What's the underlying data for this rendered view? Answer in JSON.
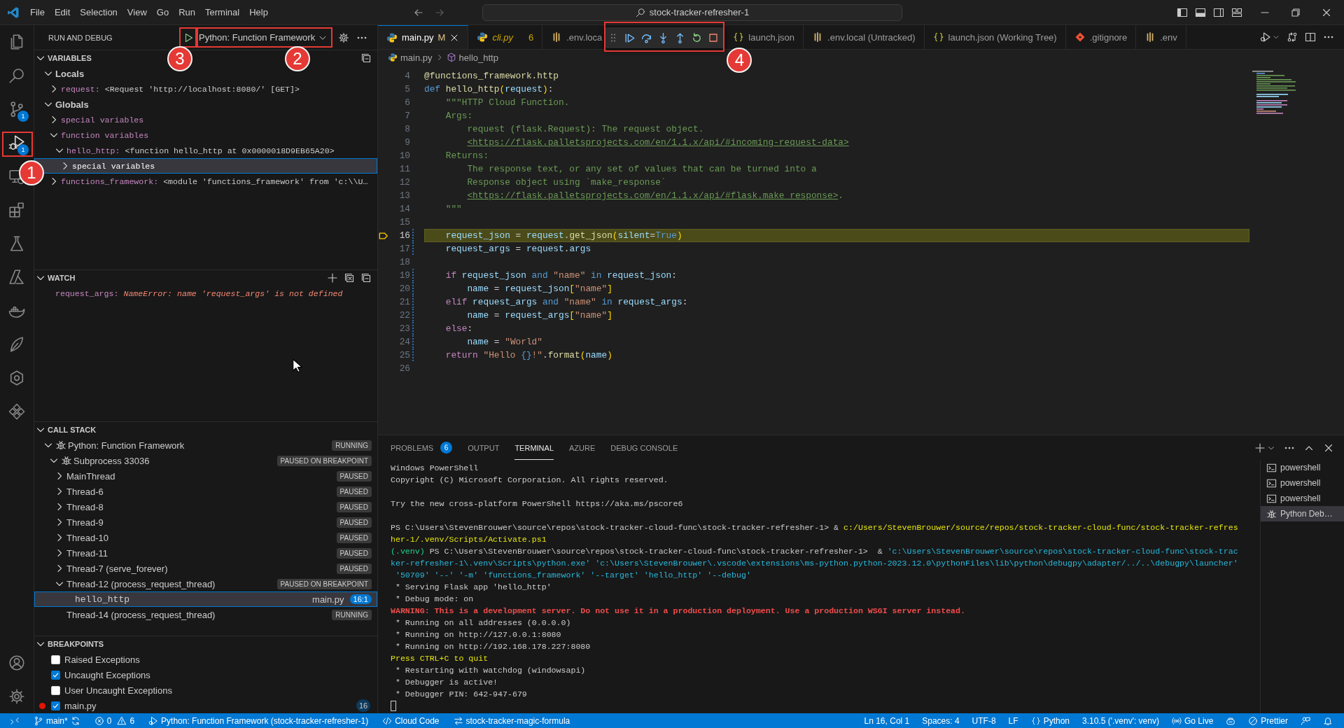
{
  "title_bar": {
    "menu": [
      "File",
      "Edit",
      "Selection",
      "View",
      "Go",
      "Run",
      "Terminal",
      "Help"
    ],
    "search": "stock-tracker-refresher-1"
  },
  "activity_bar": {
    "items": [
      {
        "selected": false
      },
      {
        "selected": false
      },
      {
        "selected": false,
        "badge": "1"
      },
      {
        "selected": true,
        "badge": "1",
        "marker": "1"
      },
      {
        "selected": false
      },
      {
        "selected": false
      },
      {
        "selected": false
      },
      {
        "selected": false
      },
      {
        "selected": false
      },
      {
        "selected": false
      },
      {
        "selected": false
      },
      {
        "selected": false
      }
    ],
    "bottom": [
      {
        "selected": false
      },
      {
        "selected": false
      }
    ]
  },
  "sidebar": {
    "title": "RUN AND DEBUG",
    "start_button": {
      "marker": "3"
    },
    "config": {
      "label": "Python: Function Framework",
      "marker": "2"
    },
    "variables": {
      "title": "VARIABLES",
      "expanded": true,
      "scopes": [
        {
          "name": "Locals",
          "expanded": true,
          "children": [
            {
              "name": "request:",
              "value": "<Request 'http://localhost:8080/' [GET]>",
              "expanded": false,
              "selected": false
            }
          ]
        },
        {
          "name": "Globals",
          "expanded": true,
          "children": [
            {
              "name": "special variables",
              "expanded": false,
              "selected": false
            },
            {
              "name": "function variables",
              "expanded": true,
              "selected": false,
              "children": [
                {
                  "name": "hello_http:",
                  "value": "<function hello_http at 0x0000018D9EB65A20>",
                  "expanded": true,
                  "selected": false,
                  "children": [
                    {
                      "name": "special variables",
                      "expanded": false,
                      "selected": true
                    }
                  ]
                }
              ]
            },
            {
              "name": "functions_framework:",
              "value": "<module 'functions_framework' from 'c:\\\\U…",
              "expanded": false,
              "selected": false
            }
          ]
        }
      ]
    },
    "watch": {
      "title": "WATCH",
      "expanded": true,
      "items": [
        {
          "name": "request_args:",
          "error": "NameError: name 'request_args' is not defined"
        }
      ]
    },
    "call_stack": {
      "title": "CALL STACK",
      "expanded": true,
      "items": [
        {
          "kind": "session",
          "label": "Python: Function Framework",
          "status": "RUNNING",
          "expanded": true,
          "selected": false,
          "children": [
            {
              "kind": "session",
              "label": "Subprocess 33036",
              "status": "PAUSED ON BREAKPOINT",
              "expanded": true,
              "selected": false,
              "children": [
                {
                  "kind": "thread",
                  "label": "MainThread",
                  "status": "PAUSED",
                  "expanded": false,
                  "selected": false
                },
                {
                  "kind": "thread",
                  "label": "Thread-6",
                  "status": "PAUSED",
                  "expanded": false,
                  "selected": false
                },
                {
                  "kind": "thread",
                  "label": "Thread-8",
                  "status": "PAUSED",
                  "expanded": false,
                  "selected": false
                },
                {
                  "kind": "thread",
                  "label": "Thread-9",
                  "status": "PAUSED",
                  "expanded": false,
                  "selected": false
                },
                {
                  "kind": "thread",
                  "label": "Thread-10",
                  "status": "PAUSED",
                  "expanded": false,
                  "selected": false
                },
                {
                  "kind": "thread",
                  "label": "Thread-11",
                  "status": "PAUSED",
                  "expanded": false,
                  "selected": false
                },
                {
                  "kind": "thread",
                  "label": "Thread-7 (serve_forever)",
                  "status": "PAUSED",
                  "expanded": false,
                  "selected": false
                },
                {
                  "kind": "thread",
                  "label": "Thread-12 (process_request_thread)",
                  "status": "PAUSED ON BREAKPOINT",
                  "expanded": true,
                  "selected": false,
                  "children": [
                    {
                      "kind": "frame",
                      "label": "hello_http",
                      "file": "main.py",
                      "position": "16:1",
                      "selected": true
                    }
                  ]
                },
                {
                  "kind": "thread",
                  "label": "Thread-14 (process_request_thread)",
                  "status": "RUNNING",
                  "selected": false
                }
              ]
            }
          ]
        }
      ]
    },
    "breakpoints": {
      "title": "BREAKPOINTS",
      "expanded": true,
      "items": [
        {
          "kind": "exception",
          "label": "Raised Exceptions",
          "checked": false
        },
        {
          "kind": "exception",
          "label": "Uncaught Exceptions",
          "checked": true
        },
        {
          "kind": "exception",
          "label": "User Uncaught Exceptions",
          "checked": false
        },
        {
          "kind": "file",
          "label": "main.py",
          "checked": true,
          "line": "16"
        }
      ]
    }
  },
  "editor": {
    "tabs": [
      {
        "kind": "python",
        "label": "main.py",
        "selected": true,
        "preview": false,
        "clipped": false,
        "git_status": "M"
      },
      {
        "kind": "python",
        "label": "cli.py",
        "selected": false,
        "preview": true,
        "clipped": false,
        "problems": "6"
      },
      {
        "kind": "env",
        "label": ".env.loca",
        "selected": false,
        "preview": false,
        "clipped": true
      },
      {
        "kind": "json",
        "label": "launch.json",
        "selected": false,
        "preview": false,
        "clipped": false
      },
      {
        "kind": "env",
        "label": ".env.local (Untracked)",
        "selected": false,
        "preview": false,
        "clipped": false
      },
      {
        "kind": "json",
        "label": "launch.json (Working Tree)",
        "selected": false,
        "preview": false,
        "clipped": false
      },
      {
        "kind": "git",
        "label": ".gitignore",
        "selected": false,
        "preview": false,
        "clipped": false
      },
      {
        "kind": "env",
        "label": ".env",
        "selected": false,
        "preview": false,
        "clipped": false
      }
    ],
    "debug_toolbar": {
      "marker": "4"
    },
    "breadcrumbs": [
      "main.py",
      "hello_http"
    ],
    "lines": [
      {
        "number": "4",
        "current": false,
        "changed": false,
        "segments": [
          {
            "kind": "fn",
            "text": "@functions_framework.http"
          }
        ]
      },
      {
        "number": "5",
        "current": false,
        "changed": false,
        "segments": [
          {
            "kind": "kw",
            "text": "def"
          },
          {
            "kind": "fn",
            "text": " hello_http"
          },
          {
            "kind": "br",
            "text": "("
          },
          {
            "kind": "var",
            "text": "request"
          },
          {
            "kind": "br",
            "text": ")"
          },
          {
            "kind": "plain",
            "text": ":"
          }
        ]
      },
      {
        "number": "6",
        "current": false,
        "changed": false,
        "segments": [
          {
            "kind": "doc",
            "text": "    \"\"\"HTTP Cloud Function."
          }
        ]
      },
      {
        "number": "7",
        "current": false,
        "changed": false,
        "segments": [
          {
            "kind": "doc",
            "text": "    Args:"
          }
        ]
      },
      {
        "number": "8",
        "current": false,
        "changed": false,
        "segments": [
          {
            "kind": "doc",
            "text": "        request (flask.Request): The request object."
          }
        ]
      },
      {
        "number": "9",
        "current": false,
        "changed": false,
        "segments": [
          {
            "kind": "link",
            "text": "        <https://flask.palletsprojects.com/en/1.1.x/api/#incoming-request-data>"
          }
        ]
      },
      {
        "number": "10",
        "current": false,
        "changed": false,
        "segments": [
          {
            "kind": "doc",
            "text": "    Returns:"
          }
        ]
      },
      {
        "number": "11",
        "current": false,
        "changed": false,
        "segments": [
          {
            "kind": "doc",
            "text": "        The response text, or any set of values that can be turned into a"
          }
        ]
      },
      {
        "number": "12",
        "current": false,
        "changed": false,
        "segments": [
          {
            "kind": "doc",
            "text": "        Response object using `make_response`"
          }
        ]
      },
      {
        "number": "13",
        "current": false,
        "changed": false,
        "segments": [
          {
            "kind": "link",
            "text": "        <https://flask.palletsprojects.com/en/1.1.x/api/#flask.make_response>"
          },
          {
            "kind": "doc",
            "text": "."
          }
        ]
      },
      {
        "number": "14",
        "current": false,
        "changed": false,
        "segments": [
          {
            "kind": "doc",
            "text": "    \"\"\""
          }
        ]
      },
      {
        "number": "15",
        "current": false,
        "changed": false
      },
      {
        "number": "16",
        "current": true,
        "changed": true,
        "segments": [
          {
            "kind": "var",
            "text": "    request_json"
          },
          {
            "kind": "plain",
            "text": " = "
          },
          {
            "kind": "var",
            "text": "request"
          },
          {
            "kind": "plain",
            "text": "."
          },
          {
            "kind": "fn",
            "text": "get_json"
          },
          {
            "kind": "br",
            "text": "("
          },
          {
            "kind": "var",
            "text": "silent"
          },
          {
            "kind": "plain",
            "text": "="
          },
          {
            "kind": "kw",
            "text": "True"
          },
          {
            "kind": "br",
            "text": ")"
          }
        ]
      },
      {
        "number": "17",
        "current": false,
        "changed": true,
        "segments": [
          {
            "kind": "var",
            "text": "    request_args"
          },
          {
            "kind": "plain",
            "text": " = "
          },
          {
            "kind": "var",
            "text": "request"
          },
          {
            "kind": "plain",
            "text": "."
          },
          {
            "kind": "var",
            "text": "args"
          }
        ]
      },
      {
        "number": "18",
        "current": false,
        "changed": false
      },
      {
        "number": "19",
        "current": false,
        "changed": true,
        "segments": [
          {
            "kind": "ctrl",
            "text": "    if"
          },
          {
            "kind": "var",
            "text": " request_json"
          },
          {
            "kind": "kw",
            "text": " and"
          },
          {
            "kind": "str",
            "text": " \"name\""
          },
          {
            "kind": "kw",
            "text": " in"
          },
          {
            "kind": "var",
            "text": " request_json"
          },
          {
            "kind": "plain",
            "text": ":"
          }
        ]
      },
      {
        "number": "20",
        "current": false,
        "changed": true,
        "segments": [
          {
            "kind": "var",
            "text": "        name"
          },
          {
            "kind": "plain",
            "text": " = "
          },
          {
            "kind": "var",
            "text": "request_json"
          },
          {
            "kind": "br",
            "text": "["
          },
          {
            "kind": "str",
            "text": "\"name\""
          },
          {
            "kind": "br",
            "text": "]"
          }
        ]
      },
      {
        "number": "21",
        "current": false,
        "changed": true,
        "segments": [
          {
            "kind": "ctrl",
            "text": "    elif"
          },
          {
            "kind": "var",
            "text": " request_args"
          },
          {
            "kind": "kw",
            "text": " and"
          },
          {
            "kind": "str",
            "text": " \"name\""
          },
          {
            "kind": "kw",
            "text": " in"
          },
          {
            "kind": "var",
            "text": " request_args"
          },
          {
            "kind": "plain",
            "text": ":"
          }
        ]
      },
      {
        "number": "22",
        "current": false,
        "changed": true,
        "segments": [
          {
            "kind": "var",
            "text": "        name"
          },
          {
            "kind": "plain",
            "text": " = "
          },
          {
            "kind": "var",
            "text": "request_args"
          },
          {
            "kind": "br",
            "text": "["
          },
          {
            "kind": "str",
            "text": "\"name\""
          },
          {
            "kind": "br",
            "text": "]"
          }
        ]
      },
      {
        "number": "23",
        "current": false,
        "changed": true,
        "segments": [
          {
            "kind": "ctrl",
            "text": "    else"
          },
          {
            "kind": "plain",
            "text": ":"
          }
        ]
      },
      {
        "number": "24",
        "current": false,
        "changed": true,
        "segments": [
          {
            "kind": "var",
            "text": "        name"
          },
          {
            "kind": "plain",
            "text": " = "
          },
          {
            "kind": "str",
            "text": "\"World\""
          }
        ]
      },
      {
        "number": "25",
        "current": false,
        "changed": true,
        "segments": [
          {
            "kind": "ctrl",
            "text": "    return"
          },
          {
            "kind": "str",
            "text": " \"Hello "
          },
          {
            "kind": "fmt",
            "text": "{}"
          },
          {
            "kind": "str",
            "text": "!\""
          },
          {
            "kind": "plain",
            "text": "."
          },
          {
            "kind": "fn",
            "text": "format"
          },
          {
            "kind": "br",
            "text": "("
          },
          {
            "kind": "var",
            "text": "name"
          },
          {
            "kind": "br",
            "text": ")"
          }
        ]
      },
      {
        "number": "26",
        "current": false,
        "changed": false
      }
    ]
  },
  "panel": {
    "tabs": [
      {
        "label": "PROBLEMS",
        "selected": false,
        "badge": "6"
      },
      {
        "label": "OUTPUT",
        "selected": false
      },
      {
        "label": "TERMINAL",
        "selected": true
      },
      {
        "label": "AZURE",
        "selected": false
      },
      {
        "label": "DEBUG CONSOLE",
        "selected": false
      }
    ],
    "terminal": {
      "rows": [
        {
          "kind": "text",
          "segments": [
            {
              "kind": "plain",
              "text": "Windows PowerShell"
            }
          ]
        },
        {
          "kind": "text",
          "segments": [
            {
              "kind": "plain",
              "text": "Copyright (C) Microsoft Corporation. All rights reserved."
            }
          ]
        },
        {
          "kind": "blank"
        },
        {
          "kind": "text",
          "segments": [
            {
              "kind": "plain",
              "text": "Try the new cross-platform PowerShell https://aka.ms/pscore6"
            }
          ]
        },
        {
          "kind": "blank"
        },
        {
          "kind": "text",
          "segments": [
            {
              "kind": "plain",
              "text": "PS C:\\Users\\StevenBrouwer\\source\\repos\\stock-tracker-cloud-func\\stock-tracker-refresher-1> & "
            },
            {
              "kind": "yellow",
              "text": "c:/Users/StevenBrouwer/source/repos/stock-tracker-cloud-func/stock-tracker-refres"
            }
          ]
        },
        {
          "kind": "text",
          "segments": [
            {
              "kind": "yellow",
              "text": "her-1/.venv/Scripts/Activate.ps1"
            }
          ]
        },
        {
          "kind": "text",
          "segments": [
            {
              "kind": "green",
              "text": "(.venv)"
            },
            {
              "kind": "plain",
              "text": " PS C:\\Users\\StevenBrouwer\\source\\repos\\stock-tracker-cloud-func\\stock-tracker-refresher-1>  & "
            },
            {
              "kind": "cyan",
              "text": "'c:\\Users\\StevenBrouwer\\source\\repos\\stock-tracker-cloud-func\\stock-trac"
            }
          ]
        },
        {
          "kind": "text",
          "segments": [
            {
              "kind": "cyan",
              "text": "ker-refresher-1\\.venv\\Scripts\\python.exe' 'c:\\Users\\StevenBrouwer\\.vscode\\extensions\\ms-python.python-2023.12.0\\pythonFiles\\lib\\python\\debugpy\\adapter/../..\\debugpy\\launcher'"
            }
          ]
        },
        {
          "kind": "text",
          "segments": [
            {
              "kind": "cyan",
              "text": " '50709' '--' '-m' 'functions_framework' '--target' 'hello_http' '--debug'"
            }
          ]
        },
        {
          "kind": "text",
          "segments": [
            {
              "kind": "plain",
              "text": " * Serving Flask app 'hello_http'"
            }
          ]
        },
        {
          "kind": "text",
          "segments": [
            {
              "kind": "plain",
              "text": " * Debug mode: on"
            }
          ]
        },
        {
          "kind": "text",
          "segments": [
            {
              "kind": "warning",
              "text": "WARNING: This is a development server. Do not use it in a production deployment. Use a production WSGI server instead."
            }
          ]
        },
        {
          "kind": "text",
          "segments": [
            {
              "kind": "plain",
              "text": " * Running on all addresses (0.0.0.0)"
            }
          ]
        },
        {
          "kind": "text",
          "segments": [
            {
              "kind": "plain",
              "text": " * Running on http://127.0.0.1:8080"
            }
          ]
        },
        {
          "kind": "text",
          "segments": [
            {
              "kind": "plain",
              "text": " * Running on http://192.168.178.227:8080"
            }
          ]
        },
        {
          "kind": "text",
          "segments": [
            {
              "kind": "yellow",
              "text": "Press CTRL+C to quit"
            }
          ]
        },
        {
          "kind": "text",
          "segments": [
            {
              "kind": "plain",
              "text": " * Restarting with watchdog (windowsapi)"
            }
          ]
        },
        {
          "kind": "text",
          "segments": [
            {
              "kind": "plain",
              "text": " * Debugger is active!"
            }
          ]
        },
        {
          "kind": "text",
          "segments": [
            {
              "kind": "plain",
              "text": " * Debugger PIN: 642-947-679"
            }
          ]
        },
        {
          "kind": "cursor"
        }
      ]
    },
    "terminals": [
      {
        "kind": "shell",
        "label": "powershell",
        "selected": false
      },
      {
        "kind": "shell",
        "label": "powershell",
        "selected": false
      },
      {
        "kind": "shell",
        "label": "powershell",
        "selected": false
      },
      {
        "kind": "debug",
        "label": "Python Deb…",
        "selected": true
      }
    ]
  },
  "status_bar": {
    "left": [
      {
        "kind": "remote"
      },
      {
        "kind": "branch",
        "text": "main*"
      },
      {
        "kind": "problems",
        "errors": "0",
        "warnings": "6"
      },
      {
        "kind": "debug",
        "text": "Python: Function Framework (stock-tracker-refresher-1)"
      },
      {
        "kind": "cloud-code",
        "text": "Cloud Code"
      },
      {
        "kind": "repo",
        "text": "stock-tracker-magic-formula"
      }
    ],
    "right": [
      {
        "kind": "text",
        "text": "Ln 16, Col 1"
      },
      {
        "kind": "text",
        "text": "Spaces: 4"
      },
      {
        "kind": "text",
        "text": "UTF-8"
      },
      {
        "kind": "text",
        "text": "LF"
      },
      {
        "kind": "language",
        "text": "Python"
      },
      {
        "kind": "text",
        "text": "3.10.5 ('.venv': venv)"
      },
      {
        "kind": "live",
        "text": "Go Live"
      },
      {
        "kind": "copilot"
      },
      {
        "kind": "prettier",
        "text": "Prettier"
      },
      {
        "kind": "feedback"
      },
      {
        "kind": "bell"
      }
    ]
  }
}
